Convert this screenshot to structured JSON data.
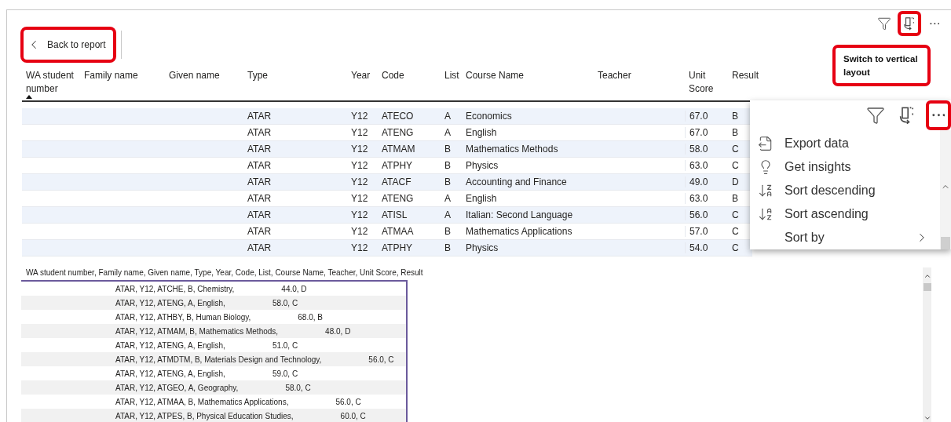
{
  "back_button": {
    "label": "Back to report",
    "highlighted": true
  },
  "visual_toolbar": [
    {
      "kind": "filter",
      "highlighted": false
    },
    {
      "kind": "layout",
      "highlighted": true
    },
    {
      "kind": "more",
      "highlighted": false
    }
  ],
  "tooltip": {
    "text": "Switch to vertical layout",
    "highlighted": true
  },
  "table": {
    "columns": [
      {
        "label": "WA student number",
        "sorted": true
      },
      {
        "label": "Family name",
        "sorted": false
      },
      {
        "label": "Given name",
        "sorted": false
      },
      {
        "label": "Type",
        "sorted": false
      },
      {
        "label": "Year",
        "sorted": false
      },
      {
        "label": "Code",
        "sorted": false
      },
      {
        "label": "List",
        "sorted": false
      },
      {
        "label": "Course Name",
        "sorted": false
      },
      {
        "label": "Teacher",
        "sorted": false
      },
      {
        "label": "Unit Score",
        "sorted": false
      },
      {
        "label": "Result",
        "sorted": false
      }
    ],
    "rows": [
      {
        "type": "ATAR",
        "year": "Y12",
        "code": "ATECO",
        "list": "A",
        "course_name": "Economics",
        "unit_score": "67.0",
        "result": "B"
      },
      {
        "type": "ATAR",
        "year": "Y12",
        "code": "ATENG",
        "list": "A",
        "course_name": "English",
        "unit_score": "67.0",
        "result": "B"
      },
      {
        "type": "ATAR",
        "year": "Y12",
        "code": "ATMAM",
        "list": "B",
        "course_name": "Mathematics Methods",
        "unit_score": "58.0",
        "result": "C"
      },
      {
        "type": "ATAR",
        "year": "Y12",
        "code": "ATPHY",
        "list": "B",
        "course_name": "Physics",
        "unit_score": "63.0",
        "result": "C"
      },
      {
        "type": "ATAR",
        "year": "Y12",
        "code": "ATACF",
        "list": "B",
        "course_name": "Accounting and Finance",
        "unit_score": "49.0",
        "result": "D"
      },
      {
        "type": "ATAR",
        "year": "Y12",
        "code": "ATENG",
        "list": "A",
        "course_name": "English",
        "unit_score": "63.0",
        "result": "B"
      },
      {
        "type": "ATAR",
        "year": "Y12",
        "code": "ATISL",
        "list": "A",
        "course_name": "Italian: Second Language",
        "unit_score": "56.0",
        "result": "C"
      },
      {
        "type": "ATAR",
        "year": "Y12",
        "code": "ATMAA",
        "list": "B",
        "course_name": "Mathematics Applications",
        "unit_score": "57.0",
        "result": "C"
      },
      {
        "type": "ATAR",
        "year": "Y12",
        "code": "ATPHY",
        "list": "B",
        "course_name": "Physics",
        "unit_score": "54.0",
        "result": "C"
      }
    ]
  },
  "context_menu": {
    "toolbar": [
      {
        "kind": "filter",
        "highlighted": false
      },
      {
        "kind": "layout",
        "highlighted": false
      },
      {
        "kind": "more",
        "highlighted": true
      }
    ],
    "items": [
      {
        "kind": "export",
        "label": "Export data",
        "submenu": false
      },
      {
        "kind": "insights",
        "label": "Get insights",
        "submenu": false
      },
      {
        "kind": "sort_desc",
        "label": "Sort descending",
        "submenu": false
      },
      {
        "kind": "sort_asc",
        "label": "Sort ascending",
        "submenu": false
      },
      {
        "kind": "none",
        "label": "Sort by",
        "submenu": true
      }
    ]
  },
  "vertical_view": {
    "header": "WA student number, Family name, Given name, Type, Year, Code, List, Course Name, Teacher, Unit Score, Result",
    "rows": [
      {
        "details": "ATAR, Y12, ATCHE, B, Chemistry,",
        "score": "44.0, D"
      },
      {
        "details": "ATAR, Y12, ATENG, A, English,",
        "score": "58.0, C"
      },
      {
        "details": "ATAR, Y12, ATHBY, B, Human Biology,",
        "score": "68.0, B"
      },
      {
        "details": "ATAR, Y12, ATMAM, B, Mathematics Methods,",
        "score": "48.0, D"
      },
      {
        "details": "ATAR, Y12, ATENG, A, English,",
        "score": "51.0, C"
      },
      {
        "details": "ATAR, Y12, ATMDTM, B, Materials Design and Technology,",
        "score": "56.0, C"
      },
      {
        "details": "ATAR, Y12, ATENG, A, English,",
        "score": "59.0, C"
      },
      {
        "details": "ATAR, Y12, ATGEO, A, Geography,",
        "score": "58.0, C"
      },
      {
        "details": "ATAR, Y12, ATMAA, B, Mathematics Applications,",
        "score": "56.0, C"
      },
      {
        "details": "ATAR, Y12, ATPES, B, Physical Education Studies,",
        "score": "60.0, C"
      }
    ]
  }
}
